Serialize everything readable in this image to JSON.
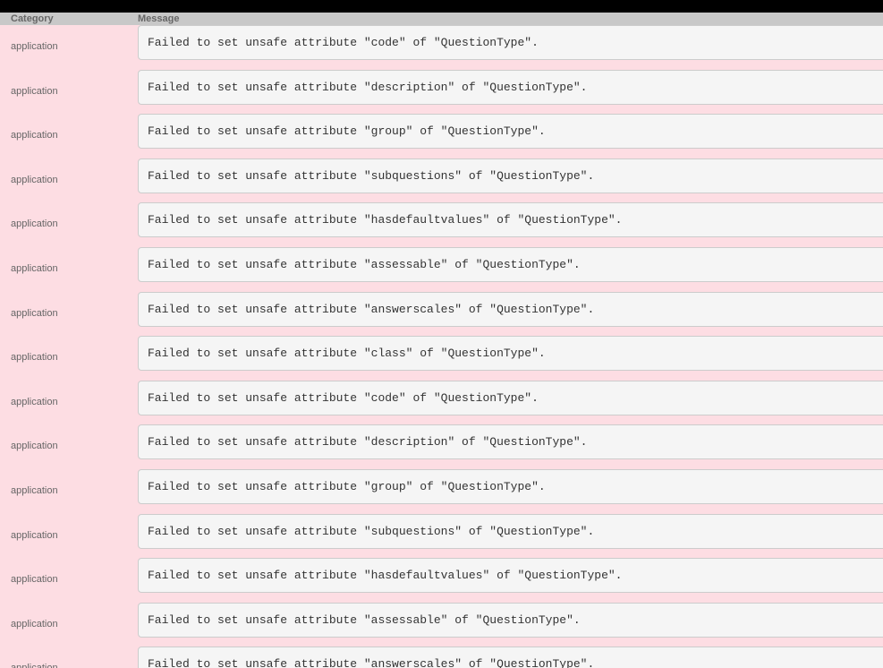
{
  "header": {
    "category": "Category",
    "message": "Message"
  },
  "rows": [
    {
      "category": "application",
      "message": "Failed to set unsafe attribute \"code\" of \"QuestionType\"."
    },
    {
      "category": "application",
      "message": "Failed to set unsafe attribute \"description\" of \"QuestionType\"."
    },
    {
      "category": "application",
      "message": "Failed to set unsafe attribute \"group\" of \"QuestionType\"."
    },
    {
      "category": "application",
      "message": "Failed to set unsafe attribute \"subquestions\" of \"QuestionType\"."
    },
    {
      "category": "application",
      "message": "Failed to set unsafe attribute \"hasdefaultvalues\" of \"QuestionType\"."
    },
    {
      "category": "application",
      "message": "Failed to set unsafe attribute \"assessable\" of \"QuestionType\"."
    },
    {
      "category": "application",
      "message": "Failed to set unsafe attribute \"answerscales\" of \"QuestionType\"."
    },
    {
      "category": "application",
      "message": "Failed to set unsafe attribute \"class\" of \"QuestionType\"."
    },
    {
      "category": "application",
      "message": "Failed to set unsafe attribute \"code\" of \"QuestionType\"."
    },
    {
      "category": "application",
      "message": "Failed to set unsafe attribute \"description\" of \"QuestionType\"."
    },
    {
      "category": "application",
      "message": "Failed to set unsafe attribute \"group\" of \"QuestionType\"."
    },
    {
      "category": "application",
      "message": "Failed to set unsafe attribute \"subquestions\" of \"QuestionType\"."
    },
    {
      "category": "application",
      "message": "Failed to set unsafe attribute \"hasdefaultvalues\" of \"QuestionType\"."
    },
    {
      "category": "application",
      "message": "Failed to set unsafe attribute \"assessable\" of \"QuestionType\"."
    },
    {
      "category": "application",
      "message": "Failed to set unsafe attribute \"answerscales\" of \"QuestionType\"."
    }
  ]
}
